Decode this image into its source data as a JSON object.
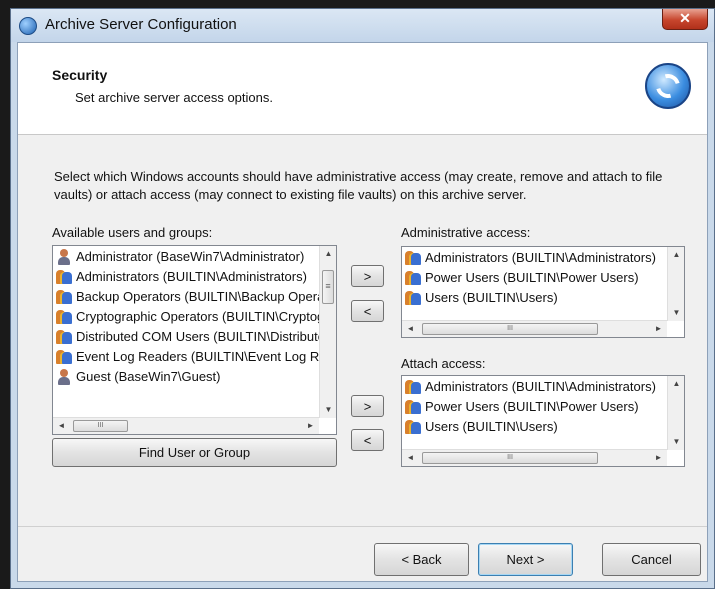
{
  "window": {
    "title": "Archive Server Configuration",
    "close_glyph": "✕"
  },
  "header": {
    "title": "Security",
    "subtitle": "Set archive server access options."
  },
  "description": "Select which Windows accounts should have administrative access (may create, remove and attach to file vaults) or attach access (may connect to existing file vaults) on this archive server.",
  "available": {
    "label": "Available users and groups:",
    "items": [
      {
        "text": "Administrator (BaseWin7\\Administrator)",
        "icon": "user-icon"
      },
      {
        "text": "Administrators (BUILTIN\\Administrators)",
        "icon": "group-icon"
      },
      {
        "text": "Backup Operators (BUILTIN\\Backup Operators)",
        "icon": "group-icon"
      },
      {
        "text": "Cryptographic Operators (BUILTIN\\Cryptographic Operators)",
        "icon": "group-icon"
      },
      {
        "text": "Distributed COM Users (BUILTIN\\Distributed COM Users)",
        "icon": "group-icon"
      },
      {
        "text": "Event Log Readers (BUILTIN\\Event Log Readers)",
        "icon": "group-icon"
      },
      {
        "text": "Guest (BaseWin7\\Guest)",
        "icon": "user-icon"
      }
    ],
    "find_button": "Find User or Group"
  },
  "admin_access": {
    "label": "Administrative access:",
    "items": [
      {
        "text": "Administrators (BUILTIN\\Administrators)",
        "icon": "group-icon"
      },
      {
        "text": "Power Users (BUILTIN\\Power Users)",
        "icon": "group-icon"
      },
      {
        "text": "Users (BUILTIN\\Users)",
        "icon": "group-icon"
      }
    ]
  },
  "attach_access": {
    "label": "Attach access:",
    "items": [
      {
        "text": "Administrators (BUILTIN\\Administrators)",
        "icon": "group-icon"
      },
      {
        "text": "Power Users (BUILTIN\\Power Users)",
        "icon": "group-icon"
      },
      {
        "text": "Users (BUILTIN\\Users)",
        "icon": "group-icon"
      }
    ]
  },
  "transfer": {
    "add": ">",
    "remove": "<"
  },
  "scroll": {
    "up": "▲",
    "down": "▼",
    "left": "◄",
    "right": "►",
    "grip_h": "III",
    "grip_v": "≡"
  },
  "footer": {
    "back": "< Back",
    "next": "Next >",
    "cancel": "Cancel"
  },
  "colors": {
    "title_close": "#c7462d",
    "header_bg": "#ffffff",
    "body_bg": "#f0f0f0"
  }
}
